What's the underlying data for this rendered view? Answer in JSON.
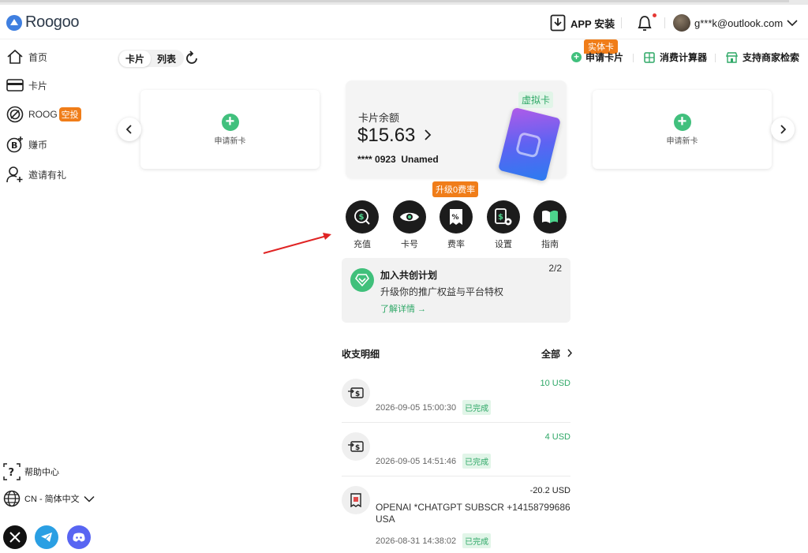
{
  "header": {
    "logo_text": "Roogoo",
    "app_install": "APP 安装",
    "user_email": "g***k@outlook.com"
  },
  "sidebar": {
    "items": [
      {
        "label": "首页",
        "icon": "home-icon"
      },
      {
        "label": "卡片",
        "icon": "card-icon"
      },
      {
        "label": "ROOG",
        "badge": "空投",
        "icon": "roog-icon"
      },
      {
        "label": "赚币",
        "icon": "earn-coin-icon"
      },
      {
        "label": "邀请有礼",
        "icon": "invite-icon"
      }
    ],
    "help": "帮助中心",
    "language": "CN - 简体中文"
  },
  "view_toggle": {
    "card": "卡片",
    "list": "列表"
  },
  "top_actions": {
    "apply": "申请卡片",
    "apply_badge": "实体卡",
    "calculator": "消费计算器",
    "merchant": "支持商家检索"
  },
  "side_cards": {
    "left_label": "申请新卡",
    "right_label": "申请新卡"
  },
  "main_card": {
    "tag": "虚拟卡",
    "balance_label": "卡片余额",
    "balance": "$15.63",
    "card_number": "**** 0923",
    "card_name": "Unamed"
  },
  "upgrade_badge": "升级0费率",
  "actions": [
    {
      "label": "充值",
      "icon": "recharge-icon"
    },
    {
      "label": "卡号",
      "icon": "eye-icon"
    },
    {
      "label": "费率",
      "icon": "rate-icon"
    },
    {
      "label": "设置",
      "icon": "settings-icon"
    },
    {
      "label": "指南",
      "icon": "book-icon"
    }
  ],
  "promo": {
    "title": "加入共创计划",
    "subtitle": "升级你的推广权益与平台特权",
    "link": "了解详情 →",
    "page": "2/2"
  },
  "transactions": {
    "title": "收支明细",
    "all": "全部",
    "items": [
      {
        "amount": "10 USD",
        "type": "in",
        "date": "2026-09-05 15:00:30",
        "status": "已完成"
      },
      {
        "amount": "4 USD",
        "type": "in",
        "date": "2026-09-05 14:51:46",
        "status": "已完成"
      },
      {
        "amount": "-20.2 USD",
        "type": "out",
        "desc": "OPENAI *CHATGPT SUBSCR +14158799686 USA",
        "date": "2026-08-31 14:38:02",
        "status": "已完成"
      }
    ]
  },
  "colors": {
    "accent_green": "#41c07d",
    "orange": "#f07d19",
    "dark": "#1c1c1c"
  }
}
